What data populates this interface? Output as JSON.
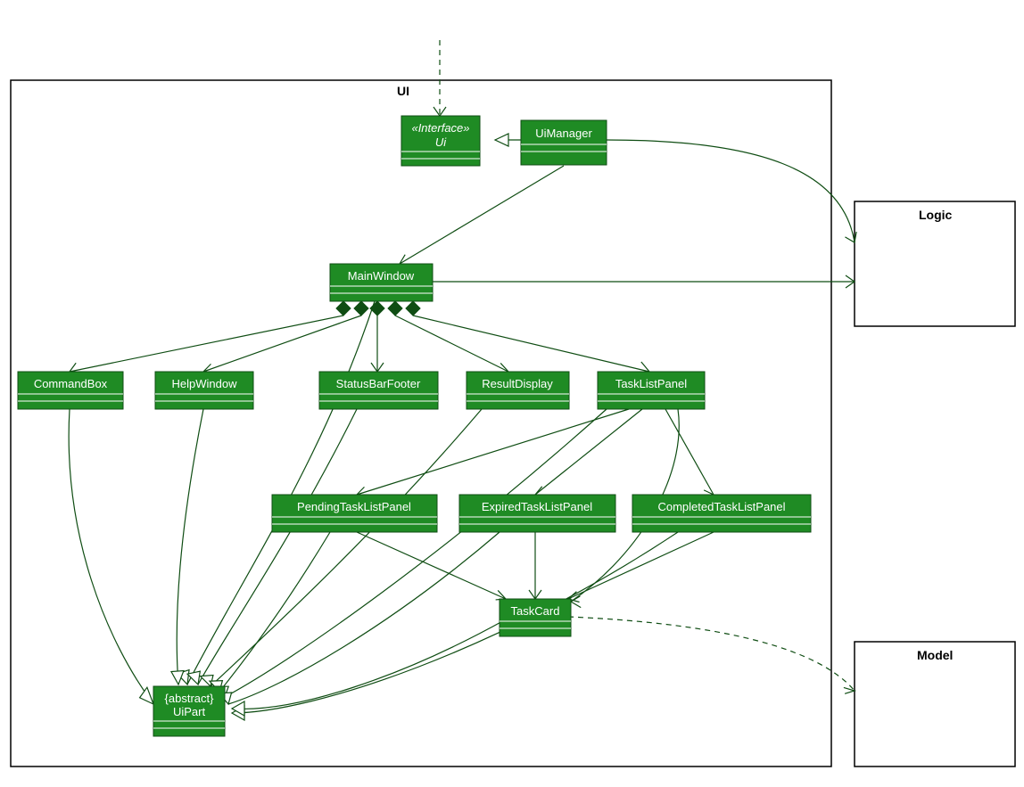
{
  "packages": {
    "ui": {
      "label": "UI"
    },
    "logic": {
      "label": "Logic"
    },
    "model": {
      "label": "Model"
    }
  },
  "classes": {
    "ui_iface": {
      "stereotype": "«Interface»",
      "name": "Ui"
    },
    "ui_manager": {
      "name": "UiManager"
    },
    "main_window": {
      "name": "MainWindow"
    },
    "command_box": {
      "name": "CommandBox"
    },
    "help_window": {
      "name": "HelpWindow"
    },
    "status_bar": {
      "name": "StatusBarFooter"
    },
    "result_display": {
      "name": "ResultDisplay"
    },
    "task_list_panel": {
      "name": "TaskListPanel"
    },
    "pending_tlp": {
      "name": "PendingTaskListPanel"
    },
    "expired_tlp": {
      "name": "ExpiredTaskListPanel"
    },
    "completed_tlp": {
      "name": "CompletedTaskListPanel"
    },
    "task_card": {
      "name": "TaskCard"
    },
    "ui_part": {
      "stereotype": "{abstract}",
      "name": "UiPart"
    }
  },
  "relations": [
    {
      "from": "external",
      "to": "ui_iface",
      "kind": "dependency"
    },
    {
      "from": "ui_manager",
      "to": "ui_iface",
      "kind": "realization"
    },
    {
      "from": "ui_manager",
      "to": "logic",
      "kind": "assoc"
    },
    {
      "from": "ui_manager",
      "to": "main_window",
      "kind": "assoc"
    },
    {
      "from": "main_window",
      "to": "logic",
      "kind": "assoc"
    },
    {
      "from": "main_window",
      "to": "command_box",
      "kind": "composition"
    },
    {
      "from": "main_window",
      "to": "help_window",
      "kind": "composition"
    },
    {
      "from": "main_window",
      "to": "status_bar",
      "kind": "composition"
    },
    {
      "from": "main_window",
      "to": "result_display",
      "kind": "composition"
    },
    {
      "from": "main_window",
      "to": "task_list_panel",
      "kind": "composition"
    },
    {
      "from": "task_list_panel",
      "to": "pending_tlp",
      "kind": "assoc"
    },
    {
      "from": "task_list_panel",
      "to": "expired_tlp",
      "kind": "assoc"
    },
    {
      "from": "task_list_panel",
      "to": "completed_tlp",
      "kind": "assoc"
    },
    {
      "from": "pending_tlp",
      "to": "task_card",
      "kind": "assoc"
    },
    {
      "from": "expired_tlp",
      "to": "task_card",
      "kind": "assoc"
    },
    {
      "from": "completed_tlp",
      "to": "task_card",
      "kind": "assoc"
    },
    {
      "from": "task_list_panel",
      "to": "task_card",
      "kind": "assoc"
    },
    {
      "from": "task_card",
      "to": "model",
      "kind": "dependency"
    },
    {
      "from": "main_window",
      "to": "ui_part",
      "kind": "inherit"
    },
    {
      "from": "command_box",
      "to": "ui_part",
      "kind": "inherit"
    },
    {
      "from": "help_window",
      "to": "ui_part",
      "kind": "inherit"
    },
    {
      "from": "status_bar",
      "to": "ui_part",
      "kind": "inherit"
    },
    {
      "from": "result_display",
      "to": "ui_part",
      "kind": "inherit"
    },
    {
      "from": "task_list_panel",
      "to": "ui_part",
      "kind": "inherit"
    },
    {
      "from": "pending_tlp",
      "to": "ui_part",
      "kind": "inherit"
    },
    {
      "from": "expired_tlp",
      "to": "ui_part",
      "kind": "inherit"
    },
    {
      "from": "completed_tlp",
      "to": "ui_part",
      "kind": "inherit"
    },
    {
      "from": "task_card",
      "to": "ui_part",
      "kind": "inherit"
    }
  ]
}
